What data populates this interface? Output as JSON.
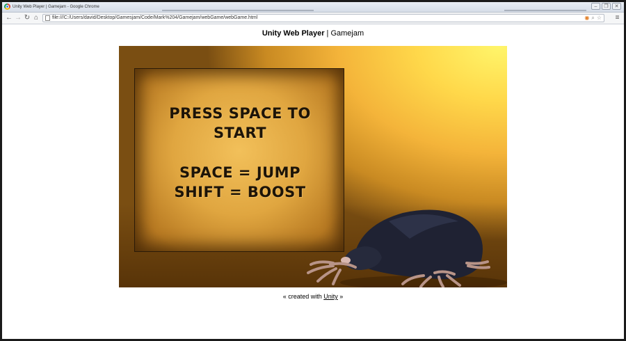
{
  "window": {
    "title": "Unity Web Player | Gamejam - Google Chrome",
    "controls": {
      "minimize": "–",
      "restore": "❐",
      "close": "✕"
    }
  },
  "toolbar": {
    "back": "←",
    "forward": "→",
    "reload": "↻",
    "home": "⌂",
    "url": "file:///C:/Users/david/Desktop/Gamesjam/Code/Mark%204/Gamejam/webGame/webGame.html",
    "menu": "≡"
  },
  "page": {
    "header_bold": "Unity Web Player",
    "header_rest": " | Gamejam",
    "footer_prefix": "« created with ",
    "footer_link": "Unity",
    "footer_suffix": " »"
  },
  "game": {
    "sign_lines": [
      "PRESS SPACE TO",
      "START",
      "SPACE = JUMP",
      "SHIFT = BOOST"
    ],
    "colors": {
      "sky_light": "#fff56a",
      "sky_mid": "#f4b43a",
      "sky_dark": "#7a4e12",
      "board": "#e0a640",
      "text": "#1d1408",
      "mole": "#1f2233",
      "paw": "#e9c7bb"
    }
  }
}
